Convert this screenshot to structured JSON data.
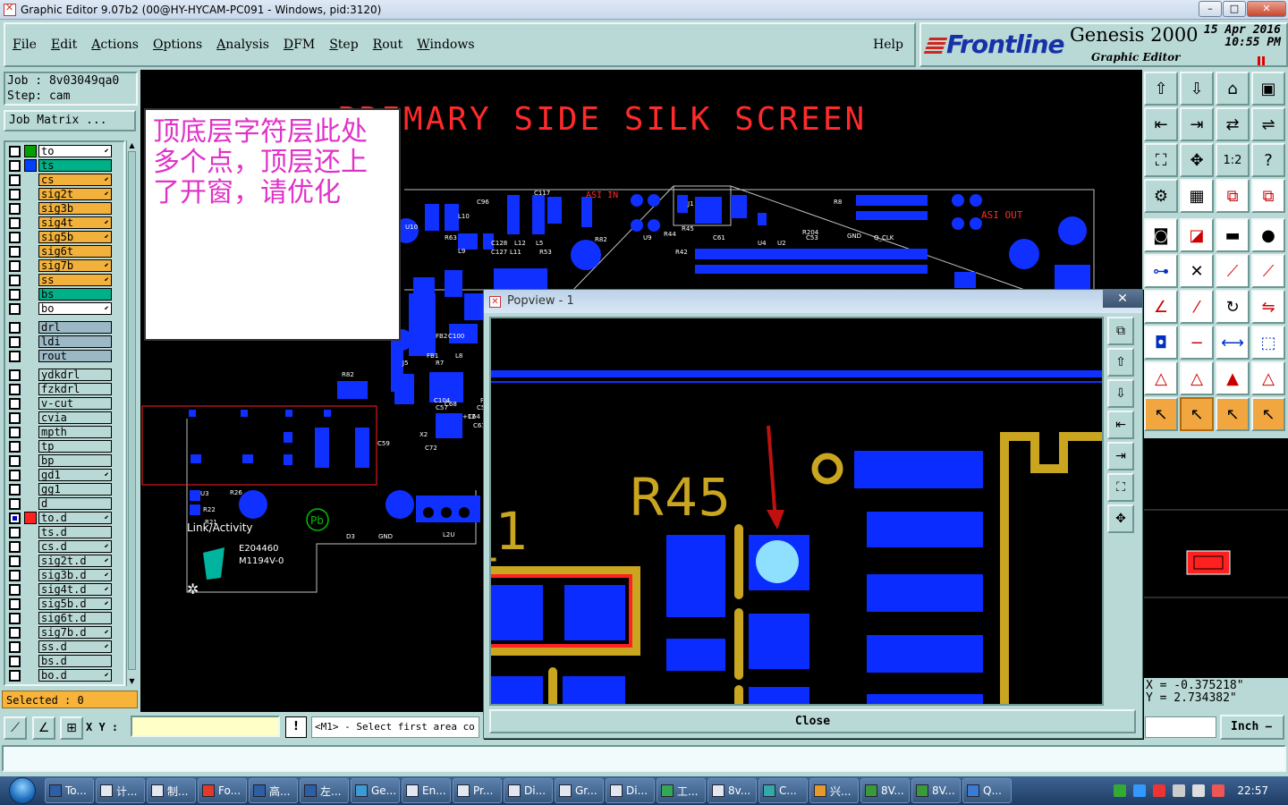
{
  "window": {
    "title": "Graphic Editor 9.07b2 (00@HY-HYCAM-PC091 - Windows, pid:3120)",
    "min": "–",
    "max": "□",
    "close": "✕"
  },
  "menu": {
    "items": [
      {
        "u": "F",
        "rest": "ile"
      },
      {
        "u": "E",
        "rest": "dit"
      },
      {
        "u": "A",
        "rest": "ctions"
      },
      {
        "u": "O",
        "rest": "ptions"
      },
      {
        "u": "A",
        "rest": "nalysis"
      },
      {
        "u": "D",
        "rest": "FM"
      },
      {
        "u": "S",
        "rest": "tep"
      },
      {
        "u": "R",
        "rest": "out"
      },
      {
        "u": "W",
        "rest": "indows"
      }
    ],
    "help": "Help"
  },
  "brand": {
    "logo": "Frontline",
    "name": "Genesis 2000",
    "sub": "Graphic Editor",
    "date": "15 Apr 2016",
    "time": "10:55 PM"
  },
  "job": {
    "job_line": "Job : 8v03049qa0",
    "step_line": "Step: cam",
    "matrix_button": "Job Matrix ..."
  },
  "layers": [
    {
      "name": "to",
      "color": "#ffffff",
      "swatch": "#00a000",
      "arrow": true,
      "checked": false,
      "gap": false
    },
    {
      "name": "ts",
      "color": "#00b088",
      "swatch": "#0040ff",
      "arrow": false,
      "checked": false,
      "gap": false
    },
    {
      "name": "cs",
      "color": "#f2b13b",
      "swatch": "",
      "arrow": true,
      "checked": false,
      "gap": false
    },
    {
      "name": "sig2t",
      "color": "#f2b13b",
      "swatch": "",
      "arrow": true,
      "checked": false,
      "gap": false
    },
    {
      "name": "sig3b",
      "color": "#f2b13b",
      "swatch": "",
      "arrow": false,
      "checked": false,
      "gap": false
    },
    {
      "name": "sig4t",
      "color": "#f2b13b",
      "swatch": "",
      "arrow": true,
      "checked": false,
      "gap": false
    },
    {
      "name": "sig5b",
      "color": "#f2b13b",
      "swatch": "",
      "arrow": true,
      "checked": false,
      "gap": false
    },
    {
      "name": "sig6t",
      "color": "#f2b13b",
      "swatch": "",
      "arrow": false,
      "checked": false,
      "gap": false
    },
    {
      "name": "sig7b",
      "color": "#f2b13b",
      "swatch": "",
      "arrow": true,
      "checked": false,
      "gap": false
    },
    {
      "name": "ss",
      "color": "#f2b13b",
      "swatch": "",
      "arrow": true,
      "checked": false,
      "gap": false
    },
    {
      "name": "bs",
      "color": "#00b088",
      "swatch": "",
      "arrow": false,
      "checked": false,
      "gap": false
    },
    {
      "name": "bo",
      "color": "#ffffff",
      "swatch": "",
      "arrow": true,
      "checked": false,
      "gap": false
    },
    {
      "name": "drl",
      "color": "#9bb8c4",
      "swatch": "",
      "arrow": false,
      "checked": false,
      "gap": true
    },
    {
      "name": "ldi",
      "color": "#9bb8c4",
      "swatch": "",
      "arrow": false,
      "checked": false,
      "gap": false
    },
    {
      "name": "rout",
      "color": "#9bb8c4",
      "swatch": "",
      "arrow": false,
      "checked": false,
      "gap": false
    },
    {
      "name": "ydkdrl",
      "color": "#b9d9d6",
      "swatch": "",
      "arrow": false,
      "checked": false,
      "gap": true
    },
    {
      "name": "fzkdrl",
      "color": "#b9d9d6",
      "swatch": "",
      "arrow": false,
      "checked": false,
      "gap": false
    },
    {
      "name": "v-cut",
      "color": "#b9d9d6",
      "swatch": "",
      "arrow": false,
      "checked": false,
      "gap": false
    },
    {
      "name": "cvia",
      "color": "#b9d9d6",
      "swatch": "",
      "arrow": false,
      "checked": false,
      "gap": false
    },
    {
      "name": "mpth",
      "color": "#b9d9d6",
      "swatch": "",
      "arrow": false,
      "checked": false,
      "gap": false
    },
    {
      "name": "tp",
      "color": "#b9d9d6",
      "swatch": "",
      "arrow": false,
      "checked": false,
      "gap": false
    },
    {
      "name": "bp",
      "color": "#b9d9d6",
      "swatch": "",
      "arrow": false,
      "checked": false,
      "gap": false
    },
    {
      "name": "gd1",
      "color": "#b9d9d6",
      "swatch": "",
      "arrow": true,
      "checked": false,
      "gap": false
    },
    {
      "name": "gg1",
      "color": "#b9d9d6",
      "swatch": "",
      "arrow": false,
      "checked": false,
      "gap": false
    },
    {
      "name": "d",
      "color": "#b9d9d6",
      "swatch": "",
      "arrow": false,
      "checked": false,
      "gap": false
    },
    {
      "name": "to.d",
      "color": "#b9d9d6",
      "swatch": "#ff2020",
      "arrow": true,
      "checked": true,
      "gap": false
    },
    {
      "name": "ts.d",
      "color": "#b9d9d6",
      "swatch": "",
      "arrow": false,
      "checked": false,
      "gap": false
    },
    {
      "name": "cs.d",
      "color": "#b9d9d6",
      "swatch": "",
      "arrow": true,
      "checked": false,
      "gap": false
    },
    {
      "name": "sig2t.d",
      "color": "#b9d9d6",
      "swatch": "",
      "arrow": true,
      "checked": false,
      "gap": false
    },
    {
      "name": "sig3b.d",
      "color": "#b9d9d6",
      "swatch": "",
      "arrow": true,
      "checked": false,
      "gap": false
    },
    {
      "name": "sig4t.d",
      "color": "#b9d9d6",
      "swatch": "",
      "arrow": true,
      "checked": false,
      "gap": false
    },
    {
      "name": "sig5b.d",
      "color": "#b9d9d6",
      "swatch": "",
      "arrow": true,
      "checked": false,
      "gap": false
    },
    {
      "name": "sig6t.d",
      "color": "#b9d9d6",
      "swatch": "",
      "arrow": false,
      "checked": false,
      "gap": false
    },
    {
      "name": "sig7b.d",
      "color": "#b9d9d6",
      "swatch": "",
      "arrow": true,
      "checked": false,
      "gap": false
    },
    {
      "name": "ss.d",
      "color": "#b9d9d6",
      "swatch": "",
      "arrow": true,
      "checked": false,
      "gap": false
    },
    {
      "name": "bs.d",
      "color": "#b9d9d6",
      "swatch": "",
      "arrow": false,
      "checked": false,
      "gap": false
    },
    {
      "name": "bo.d",
      "color": "#b9d9d6",
      "swatch": "",
      "arrow": true,
      "checked": false,
      "gap": false
    }
  ],
  "selected_text": "Selected : 0",
  "canvas": {
    "heading": "PRIMARY SIDE SILK SCREEN",
    "labels": {
      "asi_in": "ASI IN",
      "asi_out": "ASI OUT",
      "link_activity": "Link/Activity",
      "cert1": "E204460",
      "cert2": "M1194V-0",
      "pb": "Pb",
      "small": [
        "U10",
        "L10",
        "C96",
        "C117",
        "R63",
        "C128",
        "C127",
        "L9",
        "L11",
        "L12",
        "L5",
        "R53",
        "R82",
        "U9",
        "J1",
        "R45",
        "R44",
        "R42",
        "C61",
        "U4",
        "U2",
        "C53",
        "R8",
        "R204",
        "GND",
        "Q_CLK",
        "R82",
        "J5",
        "FB2",
        "FB1",
        "R7",
        "C104",
        "C100",
        "L8",
        "U5",
        "X2",
        "C72",
        "C68",
        "C57",
        "C59",
        "U3",
        "R22",
        "R21",
        "D3",
        "GND",
        "L2U",
        "+12",
        "C61",
        "C64",
        "C58",
        "FB1",
        "R26"
      ]
    },
    "colors": {
      "silk": "#ff2a2a",
      "copper": "#1030ff",
      "outline": "#c0c0c0",
      "drill_marker": "#ffffff"
    }
  },
  "popview": {
    "title": "Popview - 1",
    "label_r45": "R45",
    "label_l1": "_1",
    "close_label": "Close",
    "colors": {
      "pad": "#0a2cff",
      "silk": "#c9a520",
      "trace": "#1030ff",
      "outline_red": "#ff2020",
      "drill": "#8fe0ff"
    }
  },
  "note": {
    "text": "顶底层字符层此处多个点，顶层还上了开窗，请优化",
    "color": "#e032c8"
  },
  "coords": {
    "x": "X = -0.375218\"",
    "y": "Y = 2.734382\""
  },
  "bottom": {
    "xy_label": "X Y :",
    "prompt": "<M1> - Select first area co",
    "prompt_icon": "!",
    "unit": "Inch"
  },
  "taskbar": {
    "tasks": [
      {
        "label": "To...",
        "color": "#2d5fa5"
      },
      {
        "label": "计...",
        "color": "#e3e7ef"
      },
      {
        "label": "制...",
        "color": "#e3e7ef"
      },
      {
        "label": "Fo...",
        "color": "#e03a2a"
      },
      {
        "label": "高...",
        "color": "#2d5fa5"
      },
      {
        "label": "左...",
        "color": "#2d5fa5"
      },
      {
        "label": "Ge...",
        "color": "#3a9bd5"
      },
      {
        "label": "En...",
        "color": "#e3e7ef"
      },
      {
        "label": "Pr...",
        "color": "#e3e7ef"
      },
      {
        "label": "Di...",
        "color": "#e3e7ef"
      },
      {
        "label": "Gr...",
        "color": "#e3e7ef"
      },
      {
        "label": "Di...",
        "color": "#e3e7ef"
      },
      {
        "label": "工...",
        "color": "#34a852"
      },
      {
        "label": "8v...",
        "color": "#e3e7ef"
      },
      {
        "label": "C...",
        "color": "#3aa"
      },
      {
        "label": "兴...",
        "color": "#e69a2a"
      },
      {
        "label": "8V...",
        "color": "#3a9a3a"
      },
      {
        "label": "8V...",
        "color": "#3a9a3a"
      },
      {
        "label": "Q...",
        "color": "#3a7bd5"
      }
    ],
    "clock": "22:57"
  }
}
